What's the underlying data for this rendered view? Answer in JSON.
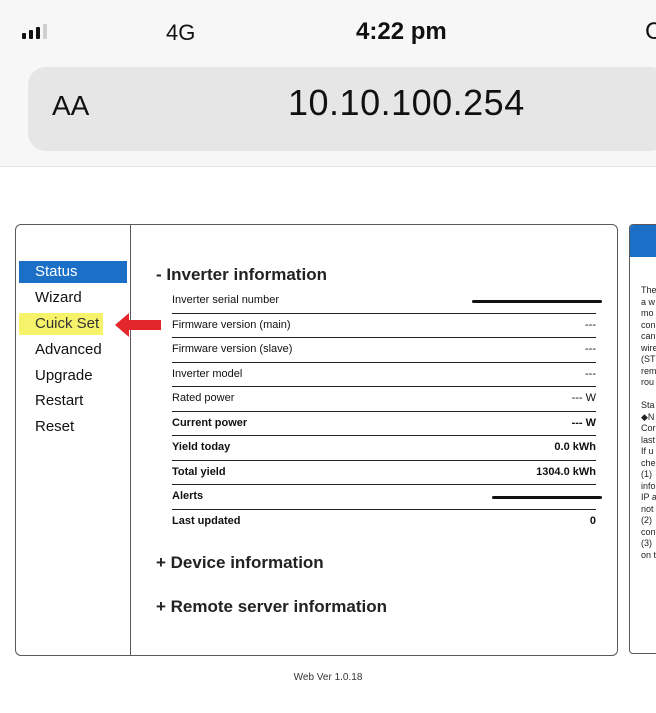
{
  "status_bar": {
    "network": "4G",
    "time": "4:22 pm",
    "cut_glyph": "C"
  },
  "address_bar": {
    "reader_button": "AA",
    "url": "10.10.100.254"
  },
  "sidebar": {
    "items": [
      {
        "label": "Status",
        "active": true
      },
      {
        "label": "Wizard"
      },
      {
        "label": "Cuick Set",
        "highlighted": true
      },
      {
        "label": "Advanced"
      },
      {
        "label": "Upgrade"
      },
      {
        "label": "Restart"
      },
      {
        "label": "Reset"
      }
    ]
  },
  "inverter": {
    "title": "- Inverter information",
    "rows": [
      {
        "label": "Inverter serial number",
        "value": "",
        "redacted": true
      },
      {
        "label": "Firmware version (main)",
        "value": "---"
      },
      {
        "label": "Firmware version (slave)",
        "value": "---"
      },
      {
        "label": "Inverter model",
        "value": "---"
      },
      {
        "label": "Rated power",
        "value": "--- W"
      },
      {
        "label": "Current power",
        "value": "--- W"
      },
      {
        "label": "Yield today",
        "value": "0.0 kWh"
      },
      {
        "label": "Total yield",
        "value": "1304.0 kWh"
      },
      {
        "label": "Alerts",
        "value": "",
        "redacted": true
      },
      {
        "label": "Last updated",
        "value": "0"
      }
    ]
  },
  "sections": {
    "device": "+ Device information",
    "remote": "+ Remote server information"
  },
  "right_panel": {
    "text_lines": [
      "The",
      "a w",
      "mo",
      "con",
      "can",
      "wire",
      "(ST",
      "rem",
      "rou",
      "",
      "Sta",
      "◆N",
      "Cor",
      "last",
      "If u",
      "che",
      "(1)",
      "info",
      "IP a",
      "not",
      "(2)",
      "con",
      "(3)",
      "on t"
    ]
  },
  "footer": "Web Ver 1.0.18",
  "colors": {
    "active_nav": "#1c6fc7",
    "highlight": "#f6f36a",
    "arrow": "#e3262a"
  }
}
